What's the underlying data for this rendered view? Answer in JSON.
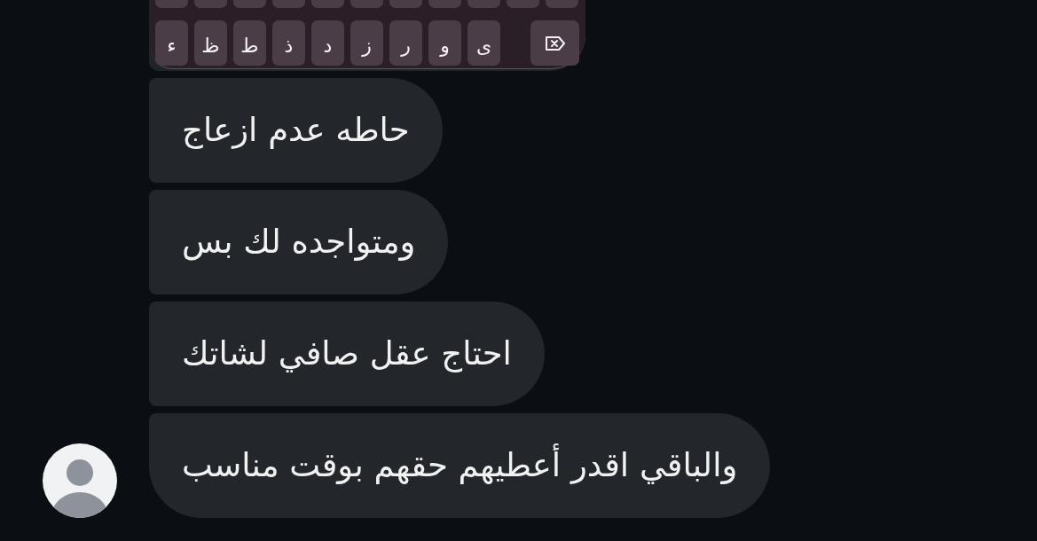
{
  "image_attachment": {
    "keyboard_bottom_row": [
      {
        "kind": "backspace"
      },
      {
        "kind": "letter",
        "label": "ى"
      },
      {
        "kind": "letter",
        "label": "و"
      },
      {
        "kind": "letter",
        "label": "ر"
      },
      {
        "kind": "letter",
        "label": "ز"
      },
      {
        "kind": "letter",
        "label": "د"
      },
      {
        "kind": "letter",
        "label": "ذ"
      },
      {
        "kind": "letter",
        "label": "ط"
      },
      {
        "kind": "letter",
        "label": "ظ"
      },
      {
        "kind": "letter",
        "label": "ء"
      }
    ]
  },
  "messages": [
    {
      "text": "حاطه عدم ازعاج"
    },
    {
      "text": "ومتواجده لك بس"
    },
    {
      "text": "احتاج عقل صافي لشاتك"
    },
    {
      "text": "والباقي اقدر أعطيهم حقهم بوقت مناسب"
    }
  ]
}
